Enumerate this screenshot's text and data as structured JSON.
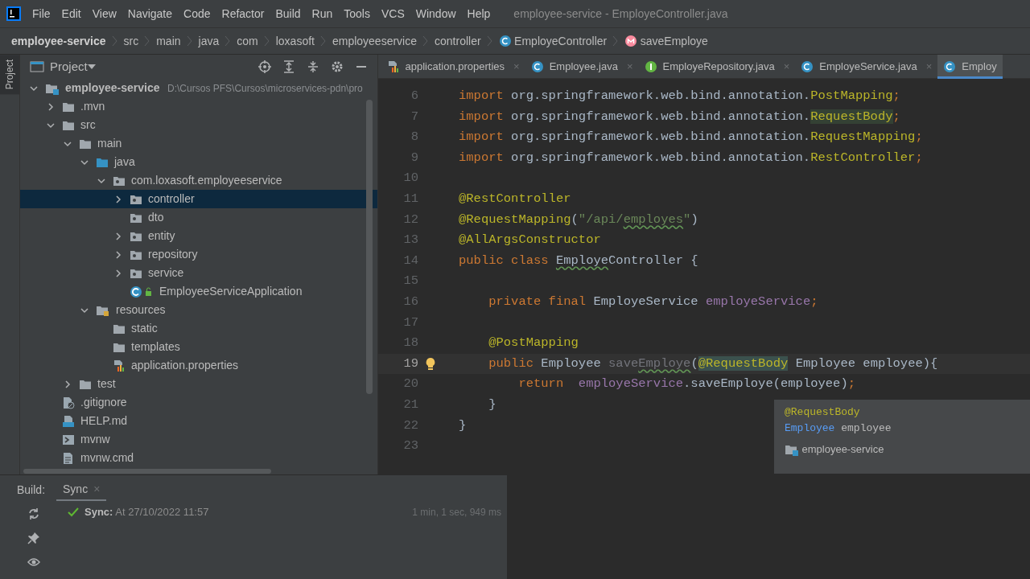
{
  "menu": [
    "File",
    "Edit",
    "View",
    "Navigate",
    "Code",
    "Refactor",
    "Build",
    "Run",
    "Tools",
    "VCS",
    "Window",
    "Help"
  ],
  "window": {
    "title": "employee-service - EmployeController.java"
  },
  "breadcrumbs": [
    {
      "label": "employee-service",
      "kind": "project"
    },
    {
      "label": "src",
      "kind": "folder"
    },
    {
      "label": "main",
      "kind": "folder"
    },
    {
      "label": "java",
      "kind": "folder"
    },
    {
      "label": "com",
      "kind": "folder"
    },
    {
      "label": "loxasoft",
      "kind": "folder"
    },
    {
      "label": "employeeservice",
      "kind": "folder"
    },
    {
      "label": "controller",
      "kind": "folder"
    },
    {
      "label": "EmployeController",
      "kind": "class"
    },
    {
      "label": "saveEmploye",
      "kind": "method"
    }
  ],
  "side_tab": "Project",
  "project_panel": {
    "title": "Project",
    "tree": [
      {
        "label": "employee-service",
        "path": "D:\\Cursos PFS\\Cursos\\microservices-pdn\\pro",
        "kind": "module",
        "expanded": true,
        "selected": false,
        "children": [
          {
            "label": ".mvn",
            "kind": "folder",
            "expanded": false,
            "selected": false
          },
          {
            "label": "src",
            "kind": "folder",
            "expanded": true,
            "selected": false,
            "children": [
              {
                "label": "main",
                "kind": "folder",
                "expanded": true,
                "selected": false,
                "children": [
                  {
                    "label": "java",
                    "kind": "source",
                    "expanded": true,
                    "selected": false,
                    "children": [
                      {
                        "label": "com.loxasoft.employeeservice",
                        "kind": "package",
                        "expanded": true,
                        "selected": false,
                        "children": [
                          {
                            "label": "controller",
                            "kind": "package",
                            "expanded": false,
                            "selected": true
                          },
                          {
                            "label": "dto",
                            "kind": "package",
                            "selected": false
                          },
                          {
                            "label": "entity",
                            "kind": "package",
                            "expanded": false,
                            "selected": false
                          },
                          {
                            "label": "repository",
                            "kind": "package",
                            "expanded": false,
                            "selected": false
                          },
                          {
                            "label": "service",
                            "kind": "package",
                            "expanded": false,
                            "selected": false
                          },
                          {
                            "label": "EmployeeServiceApplication",
                            "kind": "app",
                            "selected": false
                          }
                        ]
                      }
                    ]
                  },
                  {
                    "label": "resources",
                    "kind": "resources",
                    "expanded": true,
                    "selected": false,
                    "children": [
                      {
                        "label": "static",
                        "kind": "folder",
                        "selected": false
                      },
                      {
                        "label": "templates",
                        "kind": "folder",
                        "selected": false
                      },
                      {
                        "label": "application.properties",
                        "kind": "properties",
                        "selected": false
                      }
                    ]
                  }
                ]
              },
              {
                "label": "test",
                "kind": "folder",
                "expanded": false,
                "selected": false
              }
            ]
          },
          {
            "label": ".gitignore",
            "kind": "gitignore",
            "selected": false
          },
          {
            "label": "HELP.md",
            "kind": "markdown",
            "selected": false
          },
          {
            "label": "mvnw",
            "kind": "script",
            "selected": false
          },
          {
            "label": "mvnw.cmd",
            "kind": "cmd",
            "selected": false
          }
        ]
      }
    ]
  },
  "editor_tabs": [
    {
      "label": "application.properties",
      "kind": "properties",
      "close": "×",
      "selected": false
    },
    {
      "label": "Employee.java",
      "kind": "class",
      "close": "×",
      "selected": false
    },
    {
      "label": "EmployeRepository.java",
      "kind": "interface",
      "close": "×",
      "selected": false
    },
    {
      "label": "EmployeService.java",
      "kind": "class",
      "close": "×",
      "selected": false
    },
    {
      "label": "Employ",
      "kind": "class",
      "selected": true
    }
  ],
  "code": [
    {
      "number": "6",
      "current": false,
      "tokens": [
        {
          "t": "import",
          "kind": "kw"
        },
        {
          "t": " org.springframework.web.bind.annotation.",
          "kind": "plain"
        },
        {
          "t": "PostMapping",
          "kind": "ann"
        },
        {
          "t": ";",
          "kind": "kw"
        }
      ]
    },
    {
      "number": "7",
      "current": false,
      "tokens": [
        {
          "t": "import",
          "kind": "kw"
        },
        {
          "t": " org.springframework.web.bind.annotation.",
          "kind": "plain"
        },
        {
          "t": "RequestBody",
          "kind": "hl"
        },
        {
          "t": ";",
          "kind": "kw"
        }
      ]
    },
    {
      "number": "8",
      "current": false,
      "tokens": [
        {
          "t": "import",
          "kind": "kw"
        },
        {
          "t": " org.springframework.web.bind.annotation.",
          "kind": "plain"
        },
        {
          "t": "RequestMapping",
          "kind": "ann"
        },
        {
          "t": ";",
          "kind": "kw"
        }
      ]
    },
    {
      "number": "9",
      "current": false,
      "tokens": [
        {
          "t": "import",
          "kind": "kw"
        },
        {
          "t": " org.springframework.web.bind.annotation.",
          "kind": "plain"
        },
        {
          "t": "RestController",
          "kind": "ann"
        },
        {
          "t": ";",
          "kind": "kw"
        }
      ]
    },
    {
      "number": "10",
      "current": false
    },
    {
      "number": "11",
      "current": false,
      "tokens": [
        {
          "t": "@RestController",
          "kind": "ann"
        }
      ]
    },
    {
      "number": "12",
      "current": false,
      "tokens": [
        {
          "t": "@RequestMapping",
          "kind": "ann"
        },
        {
          "t": "(",
          "kind": "plain"
        },
        {
          "t": "\"/api/",
          "kind": "str"
        },
        {
          "t": "employes",
          "kind": "strtypo"
        },
        {
          "t": "\"",
          "kind": "str"
        },
        {
          "t": ")",
          "kind": "plain"
        }
      ]
    },
    {
      "number": "13",
      "current": false,
      "tokens": [
        {
          "t": "@AllArgsConstructor",
          "kind": "ann"
        }
      ]
    },
    {
      "number": "14",
      "current": false,
      "tokens": [
        {
          "t": "public class ",
          "kind": "kw"
        },
        {
          "t": "Employe",
          "kind": "typo"
        },
        {
          "t": "Controller {",
          "kind": "plain"
        }
      ]
    },
    {
      "number": "15",
      "current": false
    },
    {
      "number": "16",
      "current": false,
      "tokens": [
        {
          "t": "    private final ",
          "kind": "kw"
        },
        {
          "t": "EmployeService ",
          "kind": "plain"
        },
        {
          "t": "employeService",
          "kind": "field"
        },
        {
          "t": ";",
          "kind": "kw"
        }
      ]
    },
    {
      "number": "17",
      "current": false
    },
    {
      "number": "18",
      "current": false,
      "tokens": [
        {
          "t": "    @PostMapping",
          "kind": "ann"
        }
      ]
    },
    {
      "number": "19",
      "current": true,
      "tokens": [
        {
          "t": "    public ",
          "kind": "kw"
        },
        {
          "t": "Employee ",
          "kind": "plain"
        },
        {
          "t": "save",
          "kind": "unused"
        },
        {
          "t": "Employe",
          "kind": "unusedtypo"
        },
        {
          "t": "(",
          "kind": "plain"
        },
        {
          "t": "@RequestBody",
          "kind": "annhl"
        },
        {
          "t": " Employee employee){",
          "kind": "plain"
        }
      ]
    },
    {
      "number": "20",
      "current": false,
      "tokens": [
        {
          "t": "        return  ",
          "kind": "kw"
        },
        {
          "t": "employeService",
          "kind": "field"
        },
        {
          "t": ".saveEmploye(employee)",
          "kind": "plain"
        },
        {
          "t": ";",
          "kind": "kw"
        }
      ]
    },
    {
      "number": "21",
      "current": false,
      "tokens": [
        {
          "t": "    }",
          "kind": "plain"
        }
      ]
    },
    {
      "number": "22",
      "current": false,
      "tokens": [
        {
          "t": "}",
          "kind": "plain"
        }
      ]
    },
    {
      "number": "23",
      "current": false
    }
  ],
  "popup": {
    "annotation": "@RequestBody",
    "param_type": "Employee",
    "param_name": "employee",
    "module": "employee-service"
  },
  "build": {
    "label": "Build:",
    "tabs": [
      {
        "label": "Sync",
        "close": "×",
        "selected": true
      }
    ],
    "rows": [
      {
        "kind": "success",
        "text": "**Sync:** At 27/10/2022 11:57",
        "duration": "1 min, 1 sec, 949 ms"
      }
    ]
  }
}
